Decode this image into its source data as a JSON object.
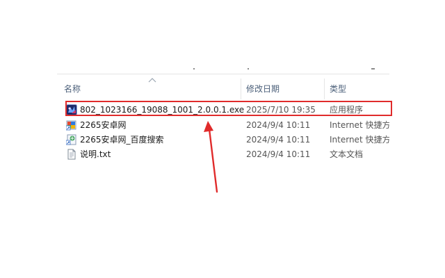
{
  "columns": {
    "name": "名称",
    "date_modified": "修改日期",
    "type": "类型"
  },
  "files": [
    {
      "icon": "exe-app-icon",
      "name": "802_1023166_19088_1001_2.0.0.1.exe",
      "date_modified": "2025/7/10 19:35",
      "type": "应用程序",
      "highlighted": true
    },
    {
      "icon": "internet-shortcut-icon",
      "name": "2265安卓网",
      "date_modified": "2024/9/4 10:11",
      "type": "Internet 快捷方"
    },
    {
      "icon": "internet-shortcut-icon",
      "name": "2265安卓网_百度搜索",
      "date_modified": "2024/9/4 10:11",
      "type": "Internet 快捷方"
    },
    {
      "icon": "text-document-icon",
      "name": "说明.txt",
      "date_modified": "2024/9/4 10:11",
      "type": "文本文档"
    }
  ],
  "sort": {
    "column": "name",
    "direction": "ascending"
  },
  "colors": {
    "annotation": "#e02b2b",
    "header_text": "#4c607a"
  }
}
